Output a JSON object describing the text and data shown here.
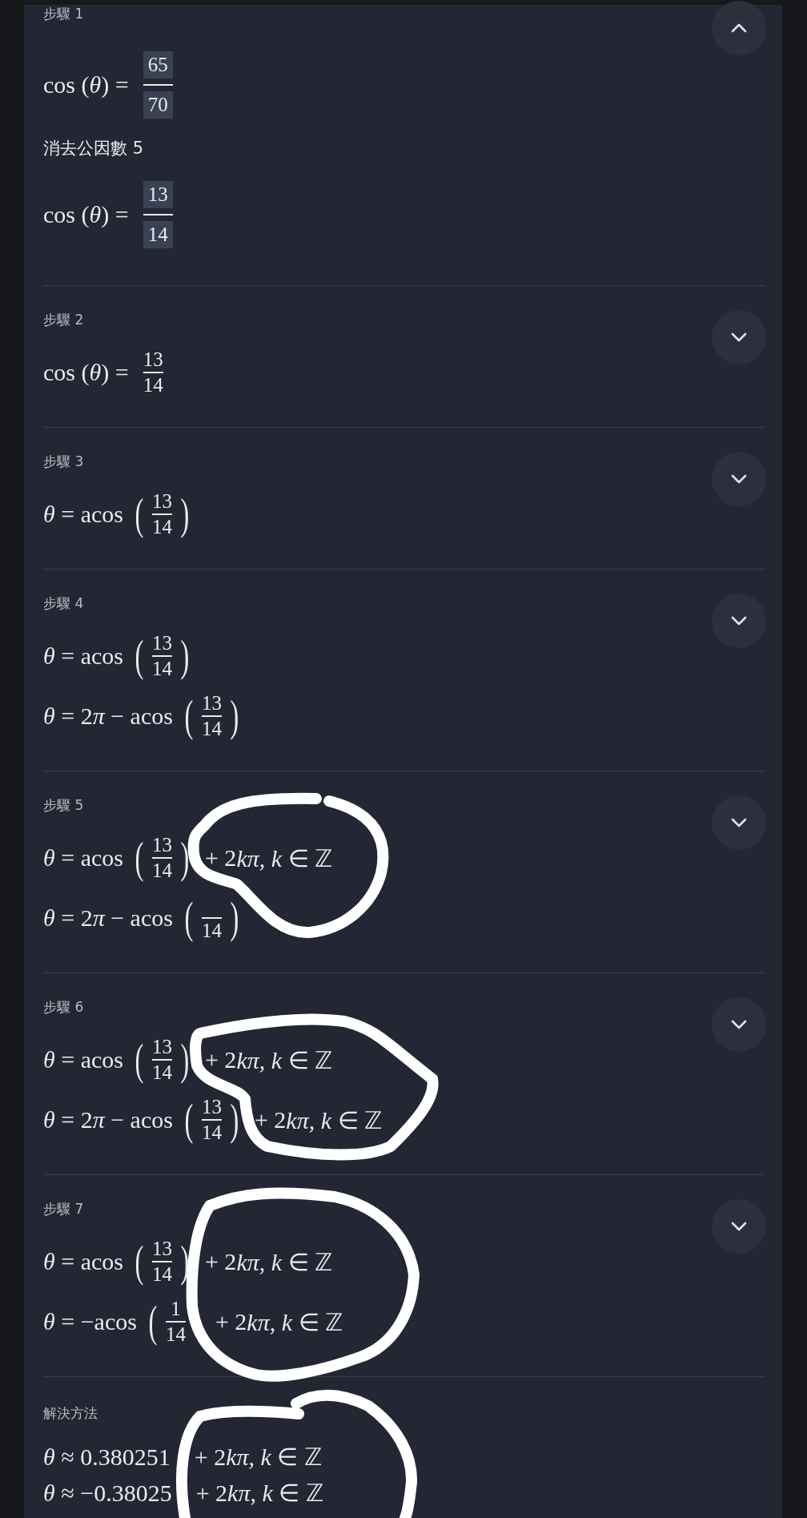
{
  "steps": [
    {
      "label": "步驟 1",
      "expanded": true,
      "blocks": [
        {
          "kind": "math",
          "items": [
            {
              "kind": "text",
              "text": "cos (*θ*) ="
            },
            {
              "kind": "frac",
              "num": "65",
              "den": "70",
              "highlight": true
            }
          ]
        },
        {
          "kind": "note",
          "text": "消去公因數 5"
        },
        {
          "kind": "math",
          "items": [
            {
              "kind": "text",
              "text": "cos (*θ*) ="
            },
            {
              "kind": "frac",
              "num": "13",
              "den": "14",
              "highlight": true
            }
          ]
        }
      ]
    },
    {
      "label": "步驟 2",
      "expanded": false,
      "blocks": [
        {
          "kind": "math",
          "items": [
            {
              "kind": "text",
              "text": "cos (*θ*) ="
            },
            {
              "kind": "frac",
              "num": "13",
              "den": "14",
              "highlight": false
            }
          ]
        }
      ]
    },
    {
      "label": "步驟 3",
      "expanded": false,
      "blocks": [
        {
          "kind": "math",
          "items": [
            {
              "kind": "text",
              "text": "*θ* = acos"
            },
            {
              "kind": "frac",
              "num": "13",
              "den": "14",
              "highlight": false,
              "open": "(",
              "close": ")"
            }
          ]
        }
      ]
    },
    {
      "label": "步驟 4",
      "expanded": false,
      "blocks": [
        {
          "kind": "math",
          "items": [
            {
              "kind": "text",
              "text": "*θ* = acos"
            },
            {
              "kind": "frac",
              "num": "13",
              "den": "14",
              "highlight": false,
              "open": "(",
              "close": ")"
            }
          ]
        },
        {
          "kind": "math",
          "items": [
            {
              "kind": "text",
              "text": "*θ* = 2"
            },
            {
              "kind": "text",
              "text": "*π* − acos"
            },
            {
              "kind": "frac",
              "num": "13",
              "den": "14",
              "highlight": false,
              "open": "(",
              "close": ")"
            }
          ]
        }
      ]
    },
    {
      "label": "步驟 5",
      "expanded": false,
      "blocks": [
        {
          "kind": "math",
          "items": [
            {
              "kind": "text",
              "text": "*θ* = acos"
            },
            {
              "kind": "frac",
              "num": "13",
              "den": "14",
              "highlight": false,
              "open": "(",
              "close": ")"
            },
            {
              "kind": "text",
              "text": "+ 2"
            },
            {
              "kind": "text",
              "text": "*kπ*, *k* ∈ ℤ"
            }
          ]
        },
        {
          "kind": "math",
          "items": [
            {
              "kind": "text",
              "text": "*θ* = 2"
            },
            {
              "kind": "text",
              "text": "*π* − acos"
            },
            {
              "kind": "frac",
              "den": "14",
              "highlight": false,
              "open": "(",
              "close": ")"
            }
          ]
        }
      ]
    },
    {
      "label": "步驟 6",
      "expanded": false,
      "blocks": [
        {
          "kind": "math",
          "items": [
            {
              "kind": "text",
              "text": "*θ* = acos"
            },
            {
              "kind": "frac",
              "num": "13",
              "den": "14",
              "highlight": false,
              "open": "(",
              "close": ")"
            },
            {
              "kind": "text",
              "text": "+ 2"
            },
            {
              "kind": "text",
              "text": "*kπ*, *k* ∈ ℤ"
            }
          ]
        },
        {
          "kind": "math",
          "items": [
            {
              "kind": "text",
              "text": "*θ* = 2"
            },
            {
              "kind": "text",
              "text": "*π* − acos"
            },
            {
              "kind": "frac",
              "num": "13",
              "den": "14",
              "highlight": false,
              "open": "(",
              "close": ")"
            },
            {
              "kind": "text",
              "text": "+ 2"
            },
            {
              "kind": "text",
              "text": "*kπ*, *k* ∈ ℤ"
            }
          ]
        }
      ]
    },
    {
      "label": "步驟 7",
      "expanded": false,
      "blocks": [
        {
          "kind": "math",
          "items": [
            {
              "kind": "text",
              "text": "*θ* = acos"
            },
            {
              "kind": "frac",
              "num": "13",
              "den": "14",
              "highlight": false,
              "open": "(",
              "close": ")"
            },
            {
              "kind": "text",
              "text": "+ 2"
            },
            {
              "kind": "text",
              "text": "*kπ*, *k* ∈ ℤ"
            }
          ]
        },
        {
          "kind": "math",
          "items": [
            {
              "kind": "text",
              "text": "*θ* = −acos"
            },
            {
              "kind": "frac",
              "num": "1",
              "den": "14",
              "highlight": false,
              "open": "("
            },
            {
              "kind": "text",
              "text": "+ 2"
            },
            {
              "kind": "text",
              "text": "*kπ*, *k* ∈ ℤ"
            }
          ]
        }
      ]
    }
  ],
  "solution": {
    "label": "解決方法",
    "lines": [
      [
        {
          "text": "*θ* ≈ 0.380251"
        },
        {
          "text": "+ 2"
        },
        {
          "text": "*kπ*, *k* ∈ ℤ"
        }
      ],
      [
        {
          "text": "*θ* ≈ −0.38025"
        },
        {
          "text": "+ 2"
        },
        {
          "text": "*kπ*, *k* ∈ ℤ"
        }
      ]
    ]
  },
  "annotations": [
    {
      "kind": "scribble"
    },
    {
      "kind": "scribble"
    },
    {
      "kind": "scribble"
    },
    {
      "kind": "scribble"
    }
  ]
}
